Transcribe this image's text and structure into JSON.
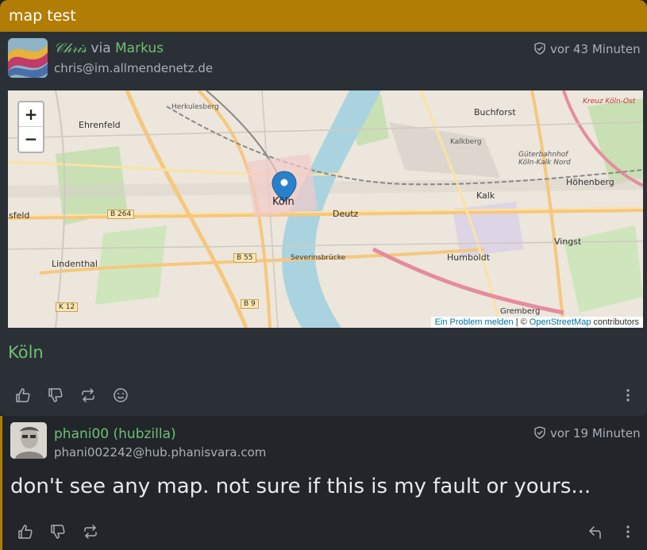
{
  "thread": {
    "title": "map test"
  },
  "post": {
    "author": "𝒞𝒽𝓇𝒾𝓈",
    "via_label": "via",
    "via_author": "Markus",
    "handle": "chris@im.allmendenetz.de",
    "time": "vor 43 Minuten",
    "map": {
      "zoom_in": "+",
      "zoom_out": "−",
      "marker_label": "Köln",
      "labels": [
        "Ehrenfeld",
        "Buchforst",
        "Kalk",
        "Höhenberg",
        "Deutz",
        "Vingst",
        "Humboldt",
        "Lindenthal",
        "Severinsbrücke",
        "B 264",
        "B 55",
        "B 9",
        "K 12",
        "Kalkberg",
        "Herkulesberg",
        "Gremberg",
        "Kreuz Köln-Ost",
        "Güterbahnhof Köln-Kalk Nord",
        "sfeld"
      ],
      "attribution_report": "Ein Problem melden",
      "attribution_sep": "| ©",
      "attribution_osm": "OpenStreetMap",
      "attribution_tail": "contributors"
    },
    "location": "Köln",
    "actions": [
      "like-icon",
      "dislike-icon",
      "repeat-icon",
      "emoji-icon",
      "more-icon"
    ]
  },
  "reply": {
    "author": "phani00 (hubzilla)",
    "handle": "phani002242@hub.phanisvara.com",
    "time": "vor 19 Minuten",
    "text": "don't see any map. not sure if this is my fault or yours...",
    "actions": [
      "like-icon",
      "dislike-icon",
      "repeat-icon",
      "reply-icon",
      "more-icon"
    ]
  },
  "colors": {
    "accent": "#b27d05",
    "link_green": "#6fbf73",
    "card": "#2b3036",
    "bg": "#22262b"
  }
}
